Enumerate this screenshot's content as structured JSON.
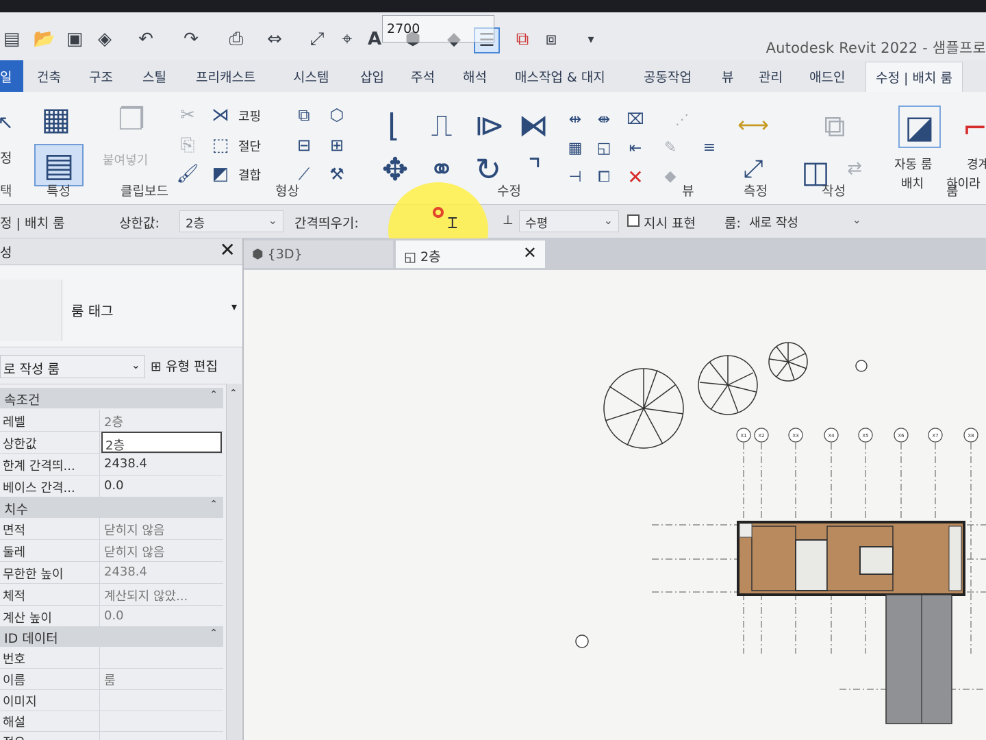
{
  "quick_access": {
    "app_title": "Autodesk Revit 2022 - 샘플프로"
  },
  "ribbon_tabs": [
    {
      "label": "일",
      "id": "file"
    },
    {
      "label": "건축"
    },
    {
      "label": "구조"
    },
    {
      "label": "스틸"
    },
    {
      "label": "프리캐스트"
    },
    {
      "label": "시스템"
    },
    {
      "label": "삽입"
    },
    {
      "label": "주석"
    },
    {
      "label": "해석"
    },
    {
      "label": "매스작업 & 대지"
    },
    {
      "label": "공동작업"
    },
    {
      "label": "뷰"
    },
    {
      "label": "관리"
    },
    {
      "label": "애드인"
    },
    {
      "label": "수정 | 배치 룸",
      "active": true
    }
  ],
  "ribbon": {
    "left_edge_label": "정",
    "paste_label": "붙여넣기",
    "cope_label": "코핑",
    "cut_label": "절단",
    "join_label": "결합",
    "auto_room_line1": "자동 룸",
    "auto_room_line2": "배치",
    "boundary_line1": "경계",
    "boundary_line2": "하이라",
    "panels": {
      "select": "택",
      "properties": "특성",
      "clipboard": "클립보드",
      "geometry": "형상",
      "modify": "수정",
      "view": "뷰",
      "measure": "측정",
      "create": "작성",
      "room": "룸"
    }
  },
  "options_bar": {
    "context": "정 | 배치 룸",
    "upper_limit_label": "상한값:",
    "upper_limit_value": "2층",
    "offset_label": "간격띄우기:",
    "offset_value": "2700",
    "orientation_value": "수평",
    "tag_checkbox_label": "지시 표현",
    "room_label": "룸:",
    "room_value": "새로 작성"
  },
  "properties_panel": {
    "title": "성",
    "type_name": "룸 태그",
    "instance_filter": "로 작성 룸",
    "edit_type_label": "유형 편집",
    "groups": [
      {
        "name": "속조건",
        "rows": [
          {
            "key": "레벨",
            "value": "2층"
          },
          {
            "key": "상한값",
            "value": "2층"
          },
          {
            "key": "한계 간격띄...",
            "value": "2438.4"
          },
          {
            "key": "베이스 간격...",
            "value": "0.0"
          }
        ]
      },
      {
        "name": "치수",
        "rows": [
          {
            "key": "면적",
            "value": "닫히지 않음"
          },
          {
            "key": "둘레",
            "value": "닫히지 않음"
          },
          {
            "key": "무한한 높이",
            "value": "2438.4"
          },
          {
            "key": "체적",
            "value": "계산되지 않았..."
          },
          {
            "key": "계산 높이",
            "value": "0.0"
          }
        ]
      },
      {
        "name": "ID 데이터",
        "rows": [
          {
            "key": "번호",
            "value": ""
          },
          {
            "key": "이름",
            "value": "룸"
          },
          {
            "key": "이미지",
            "value": ""
          },
          {
            "key": "해설",
            "value": ""
          },
          {
            "key": "점유",
            "value": ""
          }
        ]
      }
    ]
  },
  "view_tabs": [
    {
      "label": "{3D}",
      "active": false
    },
    {
      "label": "2층",
      "active": true
    }
  ],
  "drawing": {
    "grid_labels": [
      "X1",
      "X2",
      "X3",
      "X4",
      "X5",
      "X6",
      "X7",
      "X8"
    ]
  },
  "colors": {
    "file_tab": "#2a66c4",
    "room_fill": "#b98a5e",
    "highlight": "#ffee46",
    "selected_text": "#2d3a52"
  }
}
